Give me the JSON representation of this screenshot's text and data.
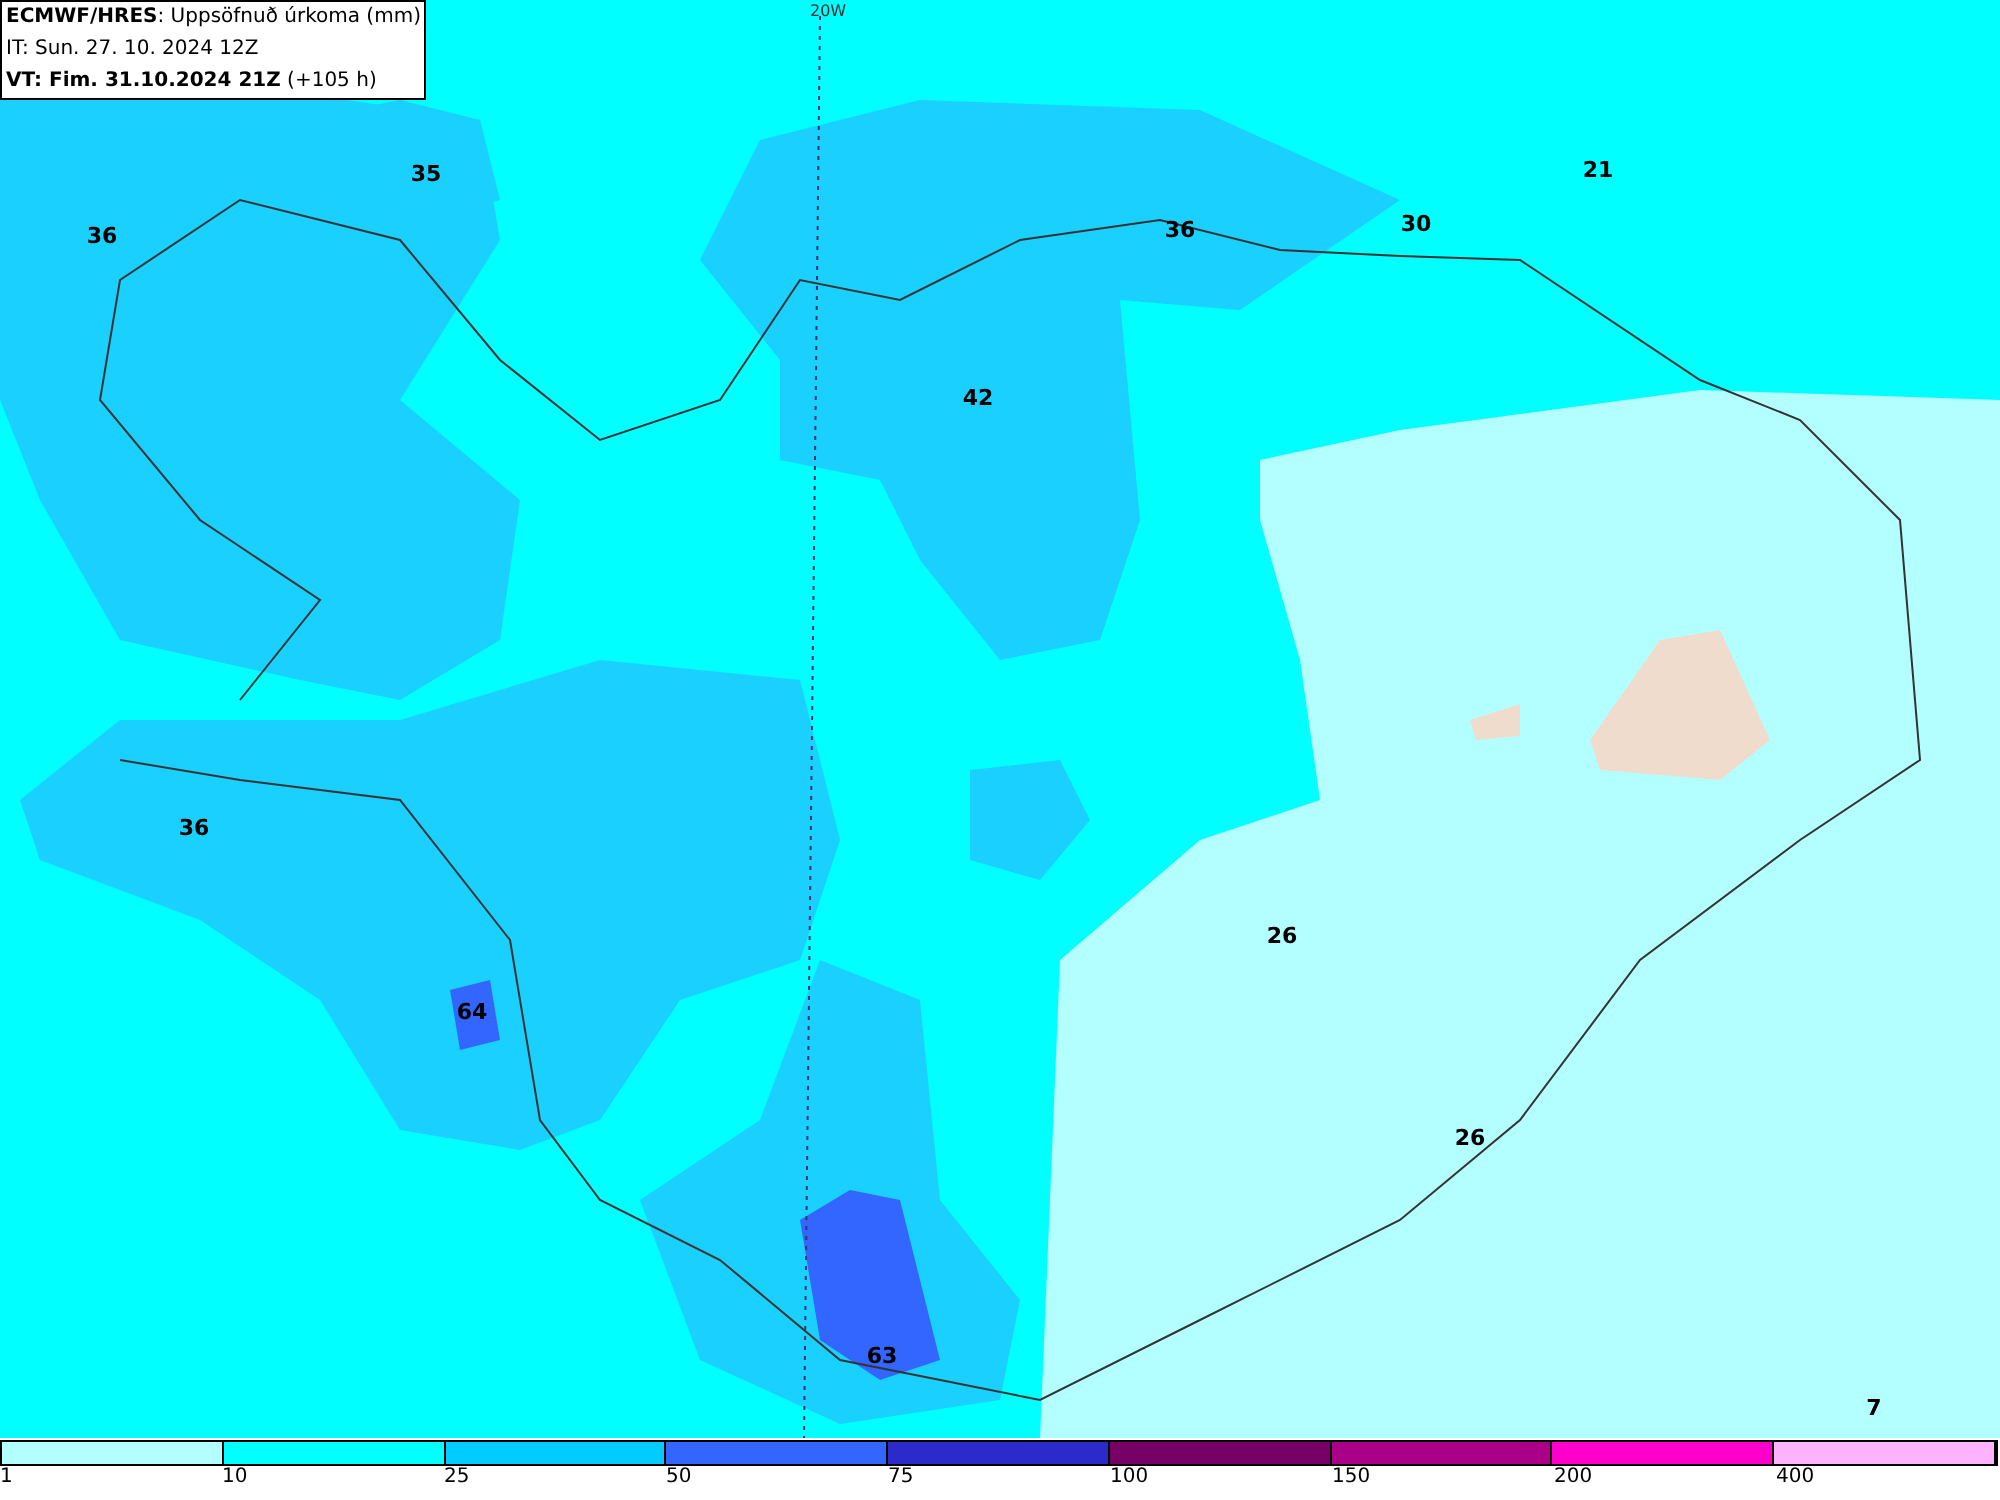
{
  "header": {
    "title": "**ECMWF/HRES**: Uppsöfnuð úrkoma (mm)",
    "init_time": "IT: Sun. 27. 10. 2024 12Z",
    "valid_time": "**VT: Fim. 31.10.2024 21Z** (+105 h)"
  },
  "meridian_label": "20W",
  "contour_labels": [
    "35",
    "36",
    "36",
    "30",
    "21",
    "42",
    "36",
    "26",
    "64",
    "26",
    "63",
    "7"
  ],
  "legend": {
    "bins": [
      {
        "color": "#b3ffff"
      },
      {
        "color": "#00ffff"
      },
      {
        "color": "#00ccff"
      },
      {
        "color": "#3366ff"
      },
      {
        "color": "#2b2bcc"
      },
      {
        "color": "#770066"
      },
      {
        "color": "#aa0088"
      },
      {
        "color": "#ff00cc"
      },
      {
        "color": "#ffb3ff"
      }
    ],
    "ticks": [
      "1",
      "10",
      "25",
      "50",
      "75",
      "100",
      "150",
      "200",
      "400"
    ]
  }
}
